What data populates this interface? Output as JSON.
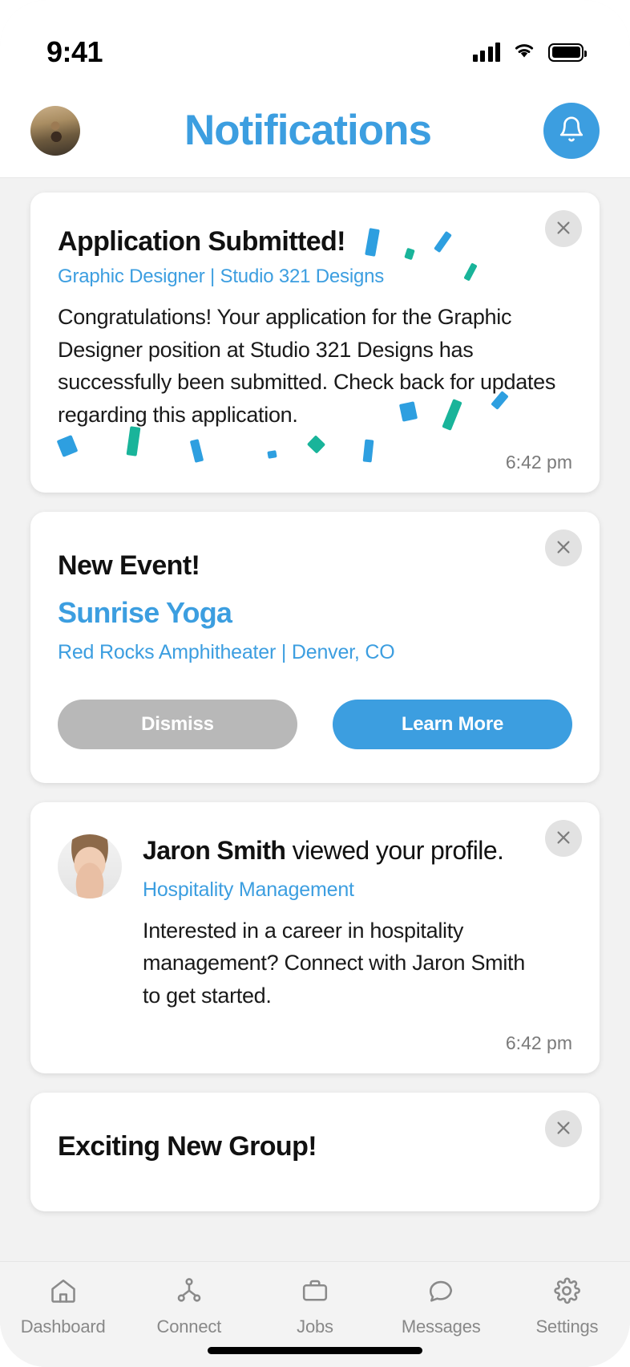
{
  "status_bar": {
    "time": "9:41",
    "signal_icon": "cellular-signal-icon",
    "wifi_icon": "wifi-icon",
    "battery_icon": "battery-full-icon"
  },
  "header": {
    "title": "Notifications",
    "avatar_name": "user-avatar",
    "bell_icon": "bell-icon",
    "accent_color": "#3c9ee0"
  },
  "notifications": [
    {
      "id": "application-submitted",
      "title": "Application Submitted!",
      "subtitle": "Graphic Designer | Studio 321 Designs",
      "body": "Congratulations! Your application for the Graphic Designer position at Studio 321 Designs has successfully been submitted. Check back for updates regarding this application.",
      "timestamp": "6:42 pm",
      "close_label": "×",
      "has_confetti": true
    },
    {
      "id": "new-event",
      "title": "New Event!",
      "event_name": "Sunrise Yoga",
      "location": "Red Rocks Amphitheater | Denver, CO",
      "dismiss_label": "Dismiss",
      "learn_more_label": "Learn More",
      "close_label": "×"
    },
    {
      "id": "profile-view",
      "person_name": "Jaron Smith",
      "headline_rest": " viewed your profile.",
      "field": "Hospitality Management",
      "body": "Interested in a career in hospitality management? Connect with Jaron Smith to get started.",
      "timestamp": "6:42 pm",
      "close_label": "×",
      "avatar_name": "jaron-smith-avatar"
    },
    {
      "id": "exciting-new-group",
      "title": "Exciting New Group!",
      "close_label": "×"
    }
  ],
  "tabbar": {
    "items": [
      {
        "label": "Dashboard",
        "icon": "home-icon"
      },
      {
        "label": "Connect",
        "icon": "network-icon"
      },
      {
        "label": "Jobs",
        "icon": "briefcase-icon"
      },
      {
        "label": "Messages",
        "icon": "chat-bubble-icon"
      },
      {
        "label": "Settings",
        "icon": "gear-icon"
      }
    ]
  },
  "colors": {
    "accent": "#3c9ee0",
    "confetti_blue": "#2e9fe0",
    "confetti_teal": "#19b49a",
    "muted_button": "#b8b8b8",
    "page_background": "#f2f2f2"
  }
}
